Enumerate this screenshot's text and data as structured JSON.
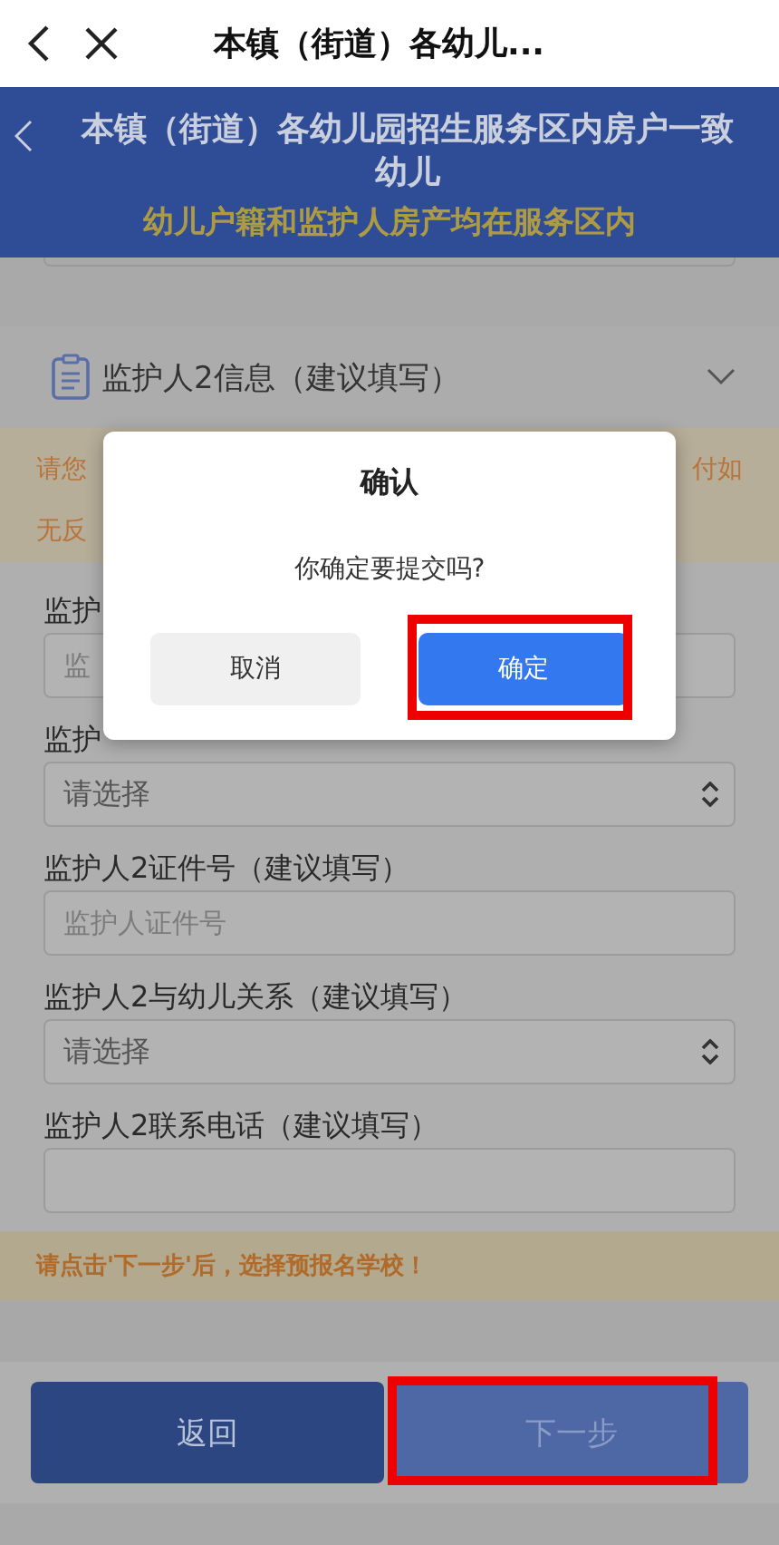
{
  "top_bar": {
    "title": "本镇（街道）各幼儿..."
  },
  "header": {
    "title": "本镇（街道）各幼儿园招生服务区内房户一致幼儿",
    "subtitle": "幼儿户籍和监护人房产均在服务区内"
  },
  "section": {
    "title": "监护人2信息（建议填写）"
  },
  "notice": {
    "line_1_left": "请您",
    "line_1_right": "付如",
    "line_2": "无反"
  },
  "fields": [
    {
      "kind": "input",
      "label": "监护",
      "placeholder": "监"
    },
    {
      "kind": "select",
      "label": "监护",
      "value": "请选择"
    },
    {
      "kind": "input",
      "label": "监护人2证件号（建议填写）",
      "placeholder": "监护人证件号"
    },
    {
      "kind": "select",
      "label": "监护人2与幼儿关系（建议填写）",
      "value": "请选择"
    },
    {
      "kind": "input",
      "label": "监护人2联系电话（建议填写）"
    }
  ],
  "hint": "请点击'下一步'后，选择预报名学校！",
  "footer": {
    "buttons": [
      {
        "kind": "back",
        "label": "返回",
        "highlighted": false
      },
      {
        "kind": "next",
        "label": "下一步",
        "highlighted": true
      }
    ]
  },
  "dialog": {
    "title": "确认",
    "message": "你确定要提交吗?",
    "buttons": [
      {
        "kind": "cancel",
        "label": "取消",
        "highlighted": false
      },
      {
        "kind": "confirm",
        "label": "确定",
        "highlighted": true
      }
    ]
  }
}
